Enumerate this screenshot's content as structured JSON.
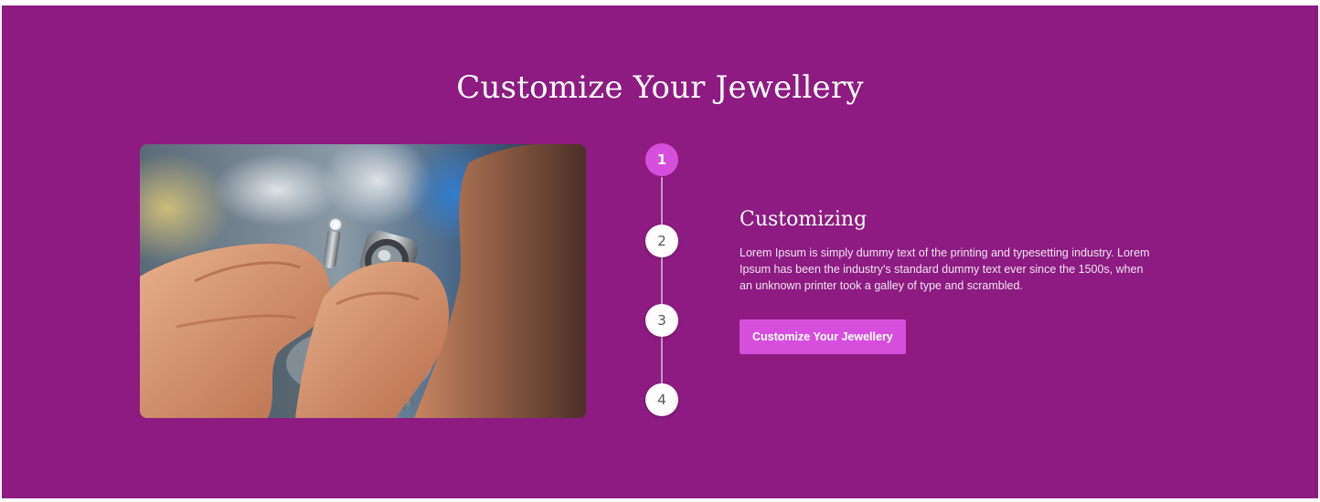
{
  "section": {
    "title": "Customize Your Jewellery",
    "background_color": "#8d1b82",
    "accent_color": "#d64fdc"
  },
  "image": {
    "alt": "Jeweller inspecting a ring with a loupe"
  },
  "steps": [
    {
      "number": "1",
      "active": true
    },
    {
      "number": "2",
      "active": false
    },
    {
      "number": "3",
      "active": false
    },
    {
      "number": "4",
      "active": false
    }
  ],
  "content": {
    "heading": "Customizing",
    "description": "Lorem Ipsum is simply dummy text of the printing and typesetting industry. Lorem Ipsum has been the industry's standard dummy text ever since the 1500s, when an unknown printer took a galley of type and scrambled.",
    "button_label": "Customize Your Jewellery"
  }
}
